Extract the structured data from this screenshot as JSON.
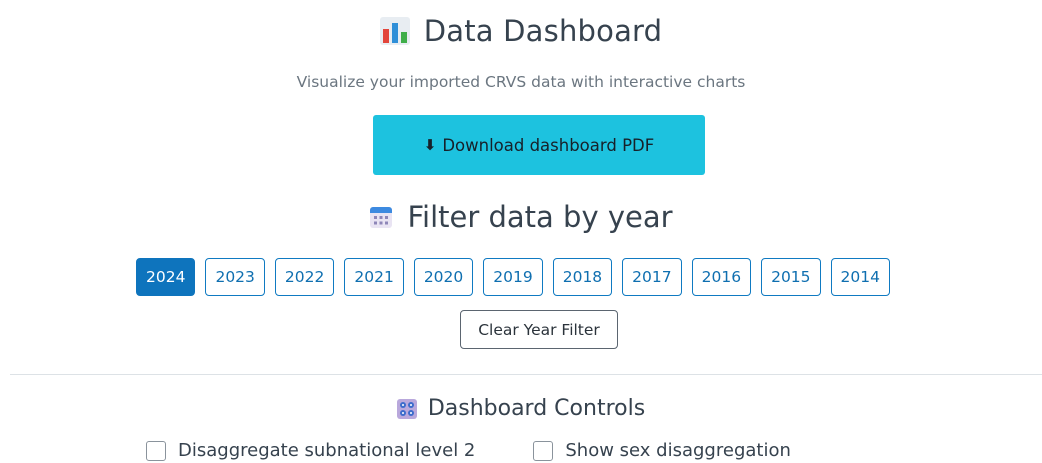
{
  "header": {
    "title": "Data Dashboard",
    "title_icon": "bar-chart-icon",
    "subtitle": "Visualize your imported CRVS data with interactive charts"
  },
  "download": {
    "arrow": "⬇",
    "label": "Download dashboard PDF",
    "color": "#1dc2df"
  },
  "year_filter": {
    "title": "Filter data by year",
    "title_icon": "calendar-icon",
    "years": [
      "2024",
      "2023",
      "2022",
      "2021",
      "2020",
      "2019",
      "2018",
      "2017",
      "2016",
      "2015",
      "2014"
    ],
    "selected": "2024",
    "clear_label": "Clear Year Filter",
    "accent_color": "#0e74bd"
  },
  "controls": {
    "title": "Dashboard Controls",
    "title_icon": "control-knobs-icon",
    "checkboxes": [
      {
        "label": "Disaggregate subnational level 2",
        "checked": false
      },
      {
        "label": "Show sex disaggregation",
        "checked": false
      }
    ]
  }
}
